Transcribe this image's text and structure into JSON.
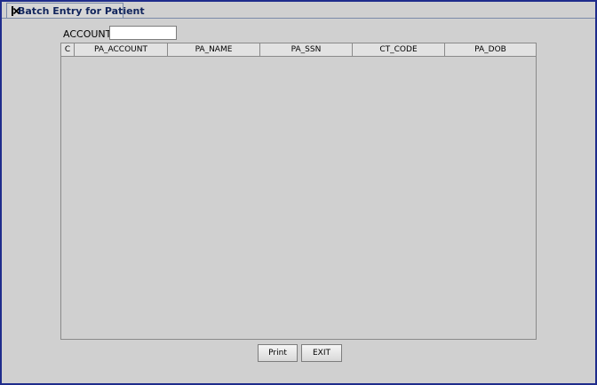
{
  "window": {
    "tab_title": "Batch Entry for Patient",
    "close_icon": "close-x-icon"
  },
  "filter": {
    "account_label": "ACCOUNT",
    "account_value": ""
  },
  "grid": {
    "columns": [
      "C",
      "PA_ACCOUNT",
      "PA_NAME",
      "PA_SSN",
      "CT_CODE",
      "PA_DOB"
    ],
    "rows": []
  },
  "actions": {
    "print_label": "Print",
    "exit_label": "EXIT"
  }
}
